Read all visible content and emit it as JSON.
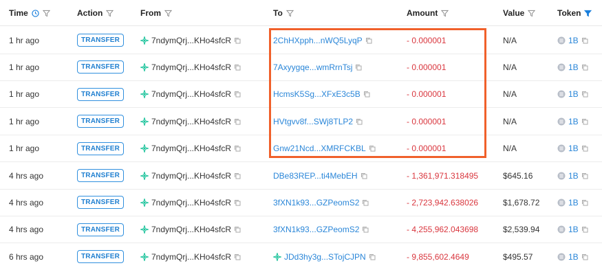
{
  "headers": {
    "time": "Time",
    "action": "Action",
    "from": "From",
    "to": "To",
    "amount": "Amount",
    "value": "Value",
    "token": "Token"
  },
  "colors": {
    "link": "#2a86d8",
    "negative": "#d9363e",
    "badge": "#1f7fd0",
    "highlight": "#f0602a",
    "token_filter_active": "#1a7fdc"
  },
  "icons": {
    "time_header": "clock-icon",
    "filter": "filter-icon",
    "address": "solana-sparkle-icon",
    "copy": "copy-icon",
    "token": "token-coin-icon"
  },
  "rows": [
    {
      "time": "1 hr ago",
      "action": "TRANSFER",
      "from": "7ndymQrj...KHo4sfcR",
      "to": "2ChHXpph...nWQ5LyqP",
      "to_icon": false,
      "amount": "- 0.000001",
      "value": "N/A",
      "token": "1B"
    },
    {
      "time": "1 hr ago",
      "action": "TRANSFER",
      "from": "7ndymQrj...KHo4sfcR",
      "to": "7Axyygqe...wmRrnTsj",
      "to_icon": false,
      "amount": "- 0.000001",
      "value": "N/A",
      "token": "1B"
    },
    {
      "time": "1 hr ago",
      "action": "TRANSFER",
      "from": "7ndymQrj...KHo4sfcR",
      "to": "HcmsK5Sg...XFxE3c5B",
      "to_icon": false,
      "amount": "- 0.000001",
      "value": "N/A",
      "token": "1B"
    },
    {
      "time": "1 hr ago",
      "action": "TRANSFER",
      "from": "7ndymQrj...KHo4sfcR",
      "to": "HVtgvv8f...SWj8TLP2",
      "to_icon": false,
      "amount": "- 0.000001",
      "value": "N/A",
      "token": "1B"
    },
    {
      "time": "1 hr ago",
      "action": "TRANSFER",
      "from": "7ndymQrj...KHo4sfcR",
      "to": "Gnw21Ncd...XMRFCKBL",
      "to_icon": false,
      "amount": "- 0.000001",
      "value": "N/A",
      "token": "1B"
    },
    {
      "time": "4 hrs ago",
      "action": "TRANSFER",
      "from": "7ndymQrj...KHo4sfcR",
      "to": "DBe83REP...ti4MebEH",
      "to_icon": false,
      "amount": "- 1,361,971.318495",
      "value": "$645.16",
      "token": "1B"
    },
    {
      "time": "4 hrs ago",
      "action": "TRANSFER",
      "from": "7ndymQrj...KHo4sfcR",
      "to": "3fXN1k93...GZPeomS2",
      "to_icon": false,
      "amount": "- 2,723,942.638026",
      "value": "$1,678.72",
      "token": "1B"
    },
    {
      "time": "4 hrs ago",
      "action": "TRANSFER",
      "from": "7ndymQrj...KHo4sfcR",
      "to": "3fXN1k93...GZPeomS2",
      "to_icon": false,
      "amount": "- 4,255,962.043698",
      "value": "$2,539.94",
      "token": "1B"
    },
    {
      "time": "6 hrs ago",
      "action": "TRANSFER",
      "from": "7ndymQrj...KHo4sfcR",
      "to": "JDd3hy3g...STojCJPN",
      "to_icon": true,
      "amount": "- 9,855,602.4649",
      "value": "$495.57",
      "token": "1B"
    }
  ]
}
